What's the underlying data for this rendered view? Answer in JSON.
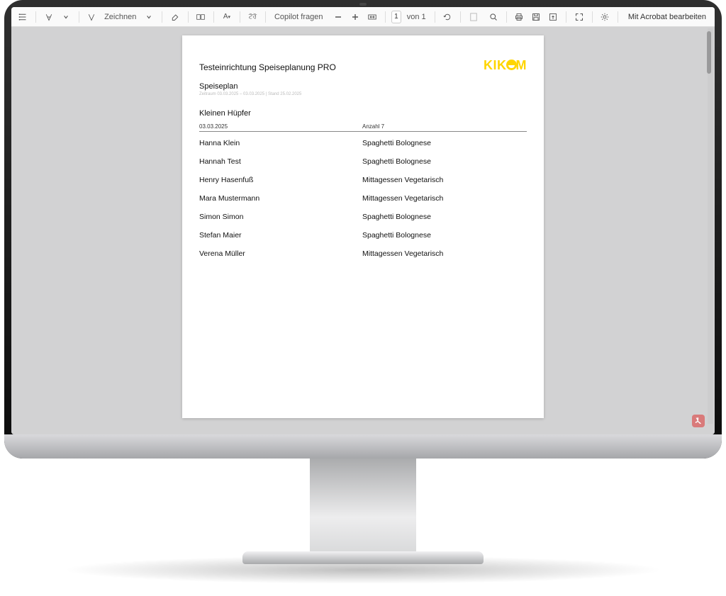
{
  "toolbar": {
    "draw_label": "Zeichnen",
    "copilot_label": "Copilot fragen",
    "page_current": "1",
    "page_of": "von 1",
    "acrobat_label": "Mit Acrobat bearbeiten"
  },
  "document": {
    "institution": "Testeinrichtung Speiseplanung PRO",
    "logo_text_pre": "KIK",
    "logo_text_post": "M",
    "subtitle": "Speiseplan",
    "date_range": "Zeitraum 03.03.2025 – 03.03.2025 | Stand 25.02.2025",
    "group": "Kleinen Hüpfer",
    "header_date": "03.03.2025",
    "header_count": "Anzahl 7",
    "rows": [
      {
        "name": "Hanna Klein",
        "meal": "Spaghetti Bolognese"
      },
      {
        "name": "Hannah Test",
        "meal": "Spaghetti Bolognese"
      },
      {
        "name": "Henry Hasenfuß",
        "meal": "Mittagessen Vegetarisch"
      },
      {
        "name": "Mara Mustermann",
        "meal": "Mittagessen Vegetarisch"
      },
      {
        "name": "Simon Simon",
        "meal": "Spaghetti Bolognese"
      },
      {
        "name": "Stefan Maier",
        "meal": "Spaghetti Bolognese"
      },
      {
        "name": "Verena Müller",
        "meal": "Mittagessen Vegetarisch"
      }
    ]
  }
}
